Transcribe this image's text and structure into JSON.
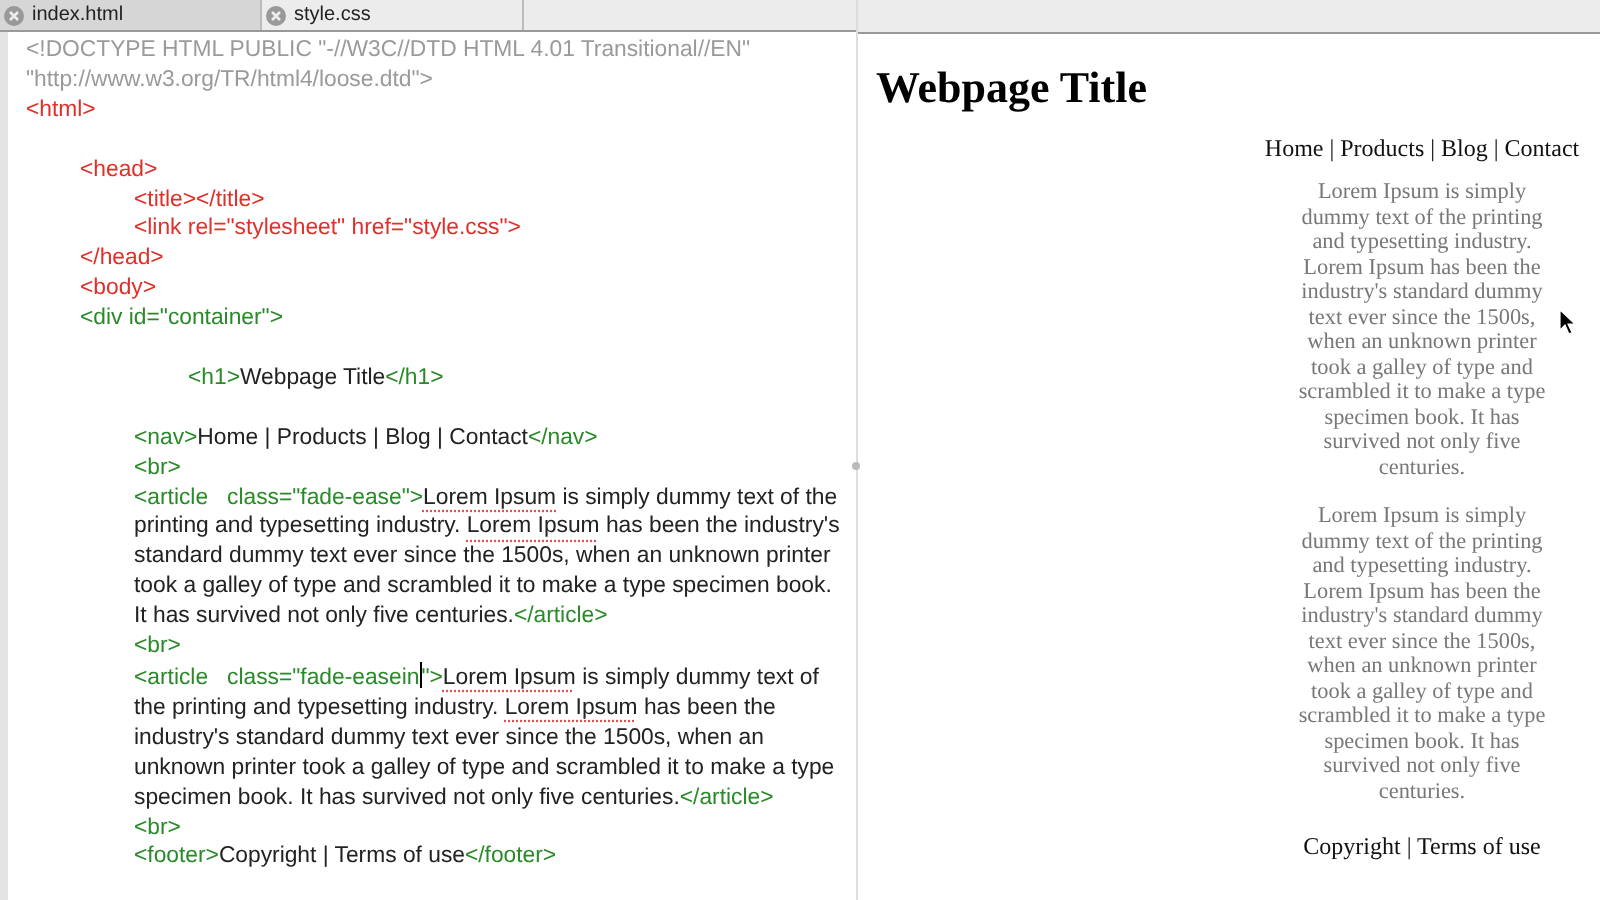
{
  "tabs": [
    {
      "label": "index.html",
      "selected": true
    },
    {
      "label": "style.css",
      "selected": false
    }
  ],
  "editor": {
    "lines": [
      {
        "kind": "code",
        "segments": [
          {
            "kind": "doctype",
            "text": "<!DOCTYPE HTML PUBLIC \"-//W3C//DTD HTML 4.01 Transitional//EN\" \"http://www.w3.org/TR/html4/loose.dtd\">"
          }
        ]
      },
      {
        "kind": "code",
        "segments": [
          {
            "kind": "tag",
            "text": "<html>"
          }
        ],
        "children": [
          {
            "kind": "blank"
          },
          {
            "kind": "code",
            "segments": [
              {
                "kind": "tag",
                "text": "<head>"
              }
            ],
            "children": [
              {
                "kind": "code",
                "segments": [
                  {
                    "kind": "tag",
                    "text": "<title></title>"
                  }
                ]
              },
              {
                "kind": "code",
                "segments": [
                  {
                    "kind": "tag",
                    "text": "<link rel=\"stylesheet\" href=\"style.css\">"
                  }
                ]
              }
            ]
          },
          {
            "kind": "code",
            "segments": [
              {
                "kind": "tag",
                "text": "</head>"
              }
            ]
          },
          {
            "kind": "code",
            "segments": [
              {
                "kind": "tag",
                "text": "<body>"
              }
            ]
          },
          {
            "kind": "code",
            "segments": [
              {
                "kind": "element",
                "text": "<div id=\"container\">"
              }
            ],
            "children": [
              {
                "kind": "blank"
              },
              {
                "kind": "group",
                "children": [
                  {
                    "kind": "code",
                    "segments": [
                      {
                        "kind": "element",
                        "text": "<h1>"
                      },
                      {
                        "kind": "text",
                        "text": "Webpage Title"
                      },
                      {
                        "kind": "element",
                        "text": "</h1>"
                      }
                    ]
                  }
                ]
              },
              {
                "kind": "blank"
              },
              {
                "kind": "code",
                "segments": [
                  {
                    "kind": "element",
                    "text": "<nav>"
                  },
                  {
                    "kind": "text",
                    "text": "Home | Products | Blog | Contact"
                  },
                  {
                    "kind": "element",
                    "text": "</nav>"
                  }
                ]
              },
              {
                "kind": "code",
                "segments": [
                  {
                    "kind": "element",
                    "text": "<br>"
                  }
                ]
              },
              {
                "kind": "code",
                "segments": [
                  {
                    "kind": "element",
                    "text": "<article   class=\"fade-ease\">"
                  },
                  {
                    "kind": "misspelled",
                    "text": "Lorem Ipsum"
                  },
                  {
                    "kind": "text",
                    "text": " is simply dummy text of the printing and typesetting industry. "
                  },
                  {
                    "kind": "misspelled",
                    "text": "Lorem Ipsum"
                  },
                  {
                    "kind": "text",
                    "text": " has been the industry's standard dummy text ever since the 1500s, when an unknown printer took a galley of type and scrambled it to make a type specimen book. It has survived not only five centuries."
                  },
                  {
                    "kind": "element",
                    "text": "</article>"
                  }
                ]
              },
              {
                "kind": "code",
                "segments": [
                  {
                    "kind": "element",
                    "text": "<br>"
                  }
                ]
              },
              {
                "kind": "code",
                "segments": [
                  {
                    "kind": "element",
                    "text": "<article   class=\"fade-easein"
                  },
                  {
                    "kind": "cursor"
                  },
                  {
                    "kind": "element",
                    "text": "\">"
                  },
                  {
                    "kind": "misspelled",
                    "text": "Lorem Ipsum"
                  },
                  {
                    "kind": "text",
                    "text": " is simply dummy text of the printing and typesetting industry. "
                  },
                  {
                    "kind": "misspelled",
                    "text": "Lorem Ipsum"
                  },
                  {
                    "kind": "text",
                    "text": " has been the industry's standard dummy text ever since the 1500s, when an unknown printer took a galley of type and scrambled it to make a type specimen book. It has survived not only five centuries."
                  },
                  {
                    "kind": "element",
                    "text": "</article>"
                  }
                ]
              },
              {
                "kind": "code",
                "segments": [
                  {
                    "kind": "element",
                    "text": "<br>"
                  }
                ]
              },
              {
                "kind": "code",
                "segments": [
                  {
                    "kind": "element",
                    "text": "<footer>"
                  },
                  {
                    "kind": "text",
                    "text": "Copyright | Terms of use"
                  },
                  {
                    "kind": "element",
                    "text": "</footer>"
                  }
                ]
              }
            ]
          }
        ]
      }
    ]
  },
  "preview": {
    "title": "Webpage Title",
    "nav": "Home | Products | Blog | Contact",
    "articles": [
      "Lorem Ipsum is simply dummy text of the printing and typesetting industry. Lorem Ipsum has been the industry's standard dummy text ever since the 1500s, when an unknown printer took a galley of type and scrambled it to make a type specimen book. It has survived not only five centuries.",
      "Lorem Ipsum is simply dummy text of the printing and typesetting industry. Lorem Ipsum has been the industry's standard dummy text ever since the 1500s, when an unknown printer took a galley of type and scrambled it to make a type specimen book. It has survived not only five centuries."
    ],
    "footer": "Copyright | Terms of use"
  }
}
